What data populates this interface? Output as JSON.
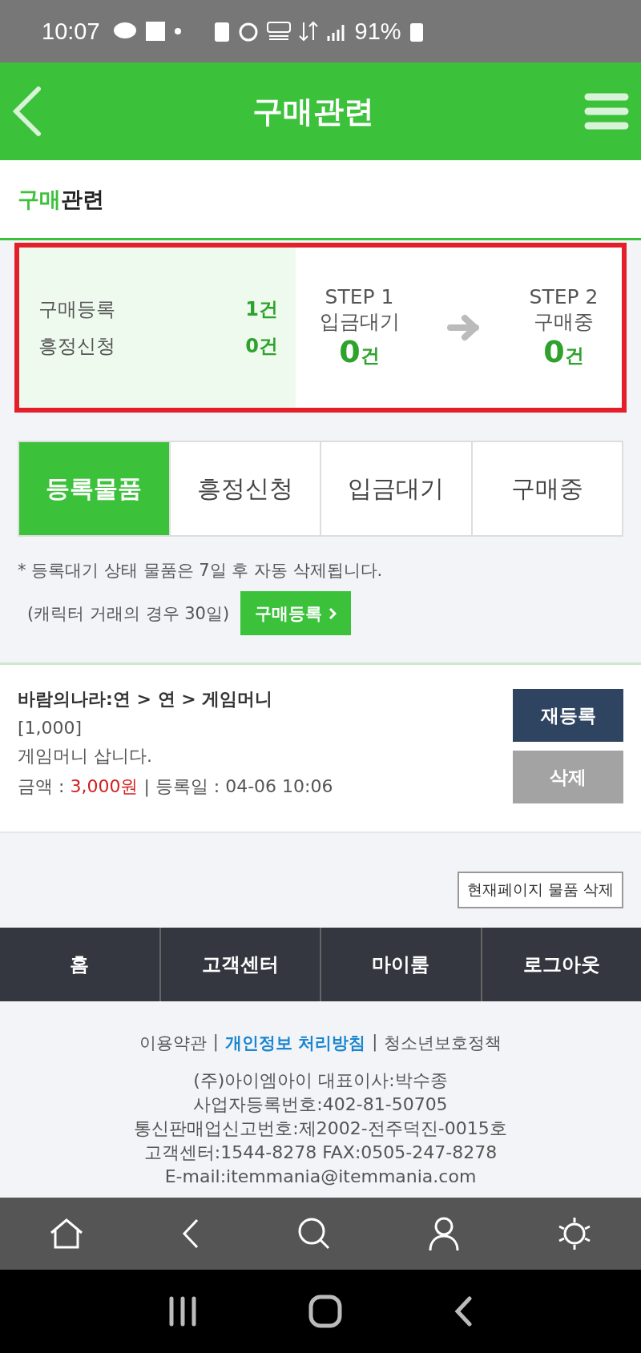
{
  "status_bar": {
    "time": "10:07",
    "battery": "91%"
  },
  "header": {
    "title": "구매관련"
  },
  "page_title": {
    "accent": "구매",
    "rest": "관련"
  },
  "summary": {
    "counts": [
      {
        "label": "구매등록",
        "value": "1건"
      },
      {
        "label": "흥정신청",
        "value": "0건"
      }
    ],
    "steps": [
      {
        "step": "STEP 1",
        "label": "입금대기",
        "count": "0",
        "unit": "건"
      },
      {
        "step": "STEP 2",
        "label": "구매중",
        "count": "0",
        "unit": "건"
      }
    ]
  },
  "tabs": [
    {
      "label": "등록물품",
      "selected": true
    },
    {
      "label": "흥정신청",
      "selected": false
    },
    {
      "label": "입금대기",
      "selected": false
    },
    {
      "label": "구매중",
      "selected": false
    }
  ],
  "notice": {
    "line1": "* 등록대기 상태 물품은 7일 후 자동 삭제됩니다.",
    "line2": "(캐릭터 거래의 경우 30일)",
    "button": "구매등록"
  },
  "items": [
    {
      "title": "바람의나라:연 > 연 > 게임머니",
      "quantity": "[1,000]",
      "description": "게임머니 삽니다.",
      "price_label": "금액 : ",
      "price": "3,000원",
      "date": " | 등록일 : 04-06 10:06",
      "buttons": [
        "재등록",
        "삭제"
      ]
    }
  ],
  "delete_page_button": "현재페이지 물품 삭제",
  "footer_nav": [
    "홈",
    "고객센터",
    "마이룸",
    "로그아웃"
  ],
  "footer_links": [
    {
      "text": "이용약관",
      "bold": false
    },
    {
      "text": "개인정보 처리방침",
      "bold": true
    },
    {
      "text": "청소년보호정책",
      "bold": false
    }
  ],
  "footer_link_separator": "|",
  "company_info": [
    "(주)아이엠아이 대표이사:박수종",
    "사업자등록번호:402-81-50705",
    "통신판매업신고번호:제2002-전주덕진-0015호",
    "고객센터:1544-8278 FAX:0505-247-8278",
    "E-mail:itemmania@itemmania.com"
  ]
}
